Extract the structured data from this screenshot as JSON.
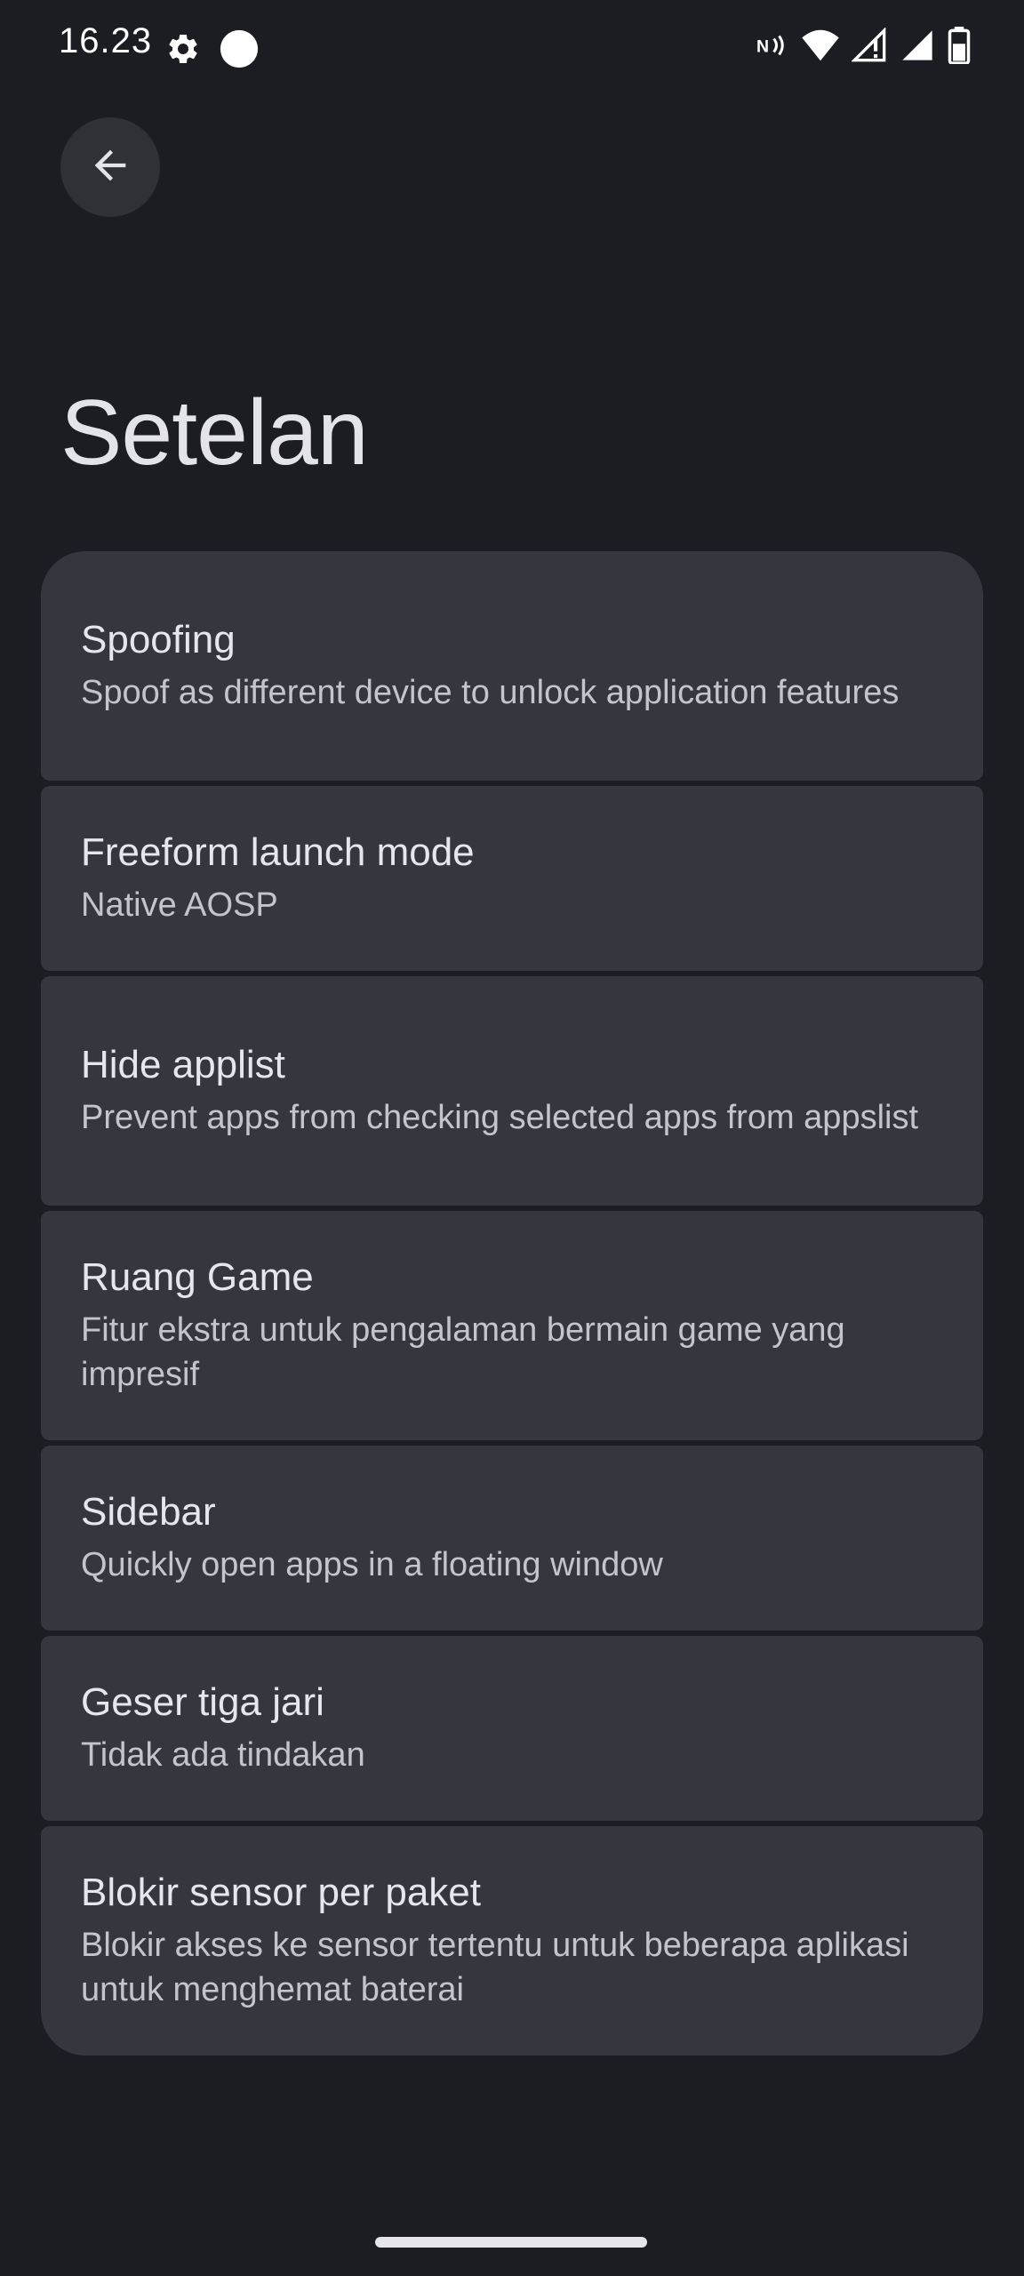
{
  "status_bar": {
    "time": "16.23",
    "left_icons": [
      "gear-icon",
      "circle-icon"
    ],
    "right_icons": [
      "nfc-icon",
      "wifi-icon",
      "signal-icon",
      "signal-icon",
      "battery-icon"
    ]
  },
  "header": {
    "back_icon": "arrow-left-icon",
    "title": "Setelan"
  },
  "settings": [
    {
      "title": "Spoofing",
      "subtitle": "Spoof as different device to unlock application features"
    },
    {
      "title": "Freeform launch mode",
      "subtitle": "Native AOSP"
    },
    {
      "title": "Hide applist",
      "subtitle": "Prevent apps from checking selected apps from appslist"
    },
    {
      "title": "Ruang Game",
      "subtitle": "Fitur ekstra untuk pengalaman bermain game yang impresif"
    },
    {
      "title": "Sidebar",
      "subtitle": "Quickly open apps in a floating window"
    },
    {
      "title": "Geser tiga jari",
      "subtitle": "Tidak ada tindakan"
    },
    {
      "title": "Blokir sensor per paket",
      "subtitle": "Blokir akses ke sensor tertentu untuk beberapa aplikasi untuk menghemat baterai"
    }
  ],
  "colors": {
    "background": "#1b1d22",
    "card": "#36373e",
    "text_primary": "#e6e6ec",
    "text_secondary": "#c4c5cc"
  }
}
